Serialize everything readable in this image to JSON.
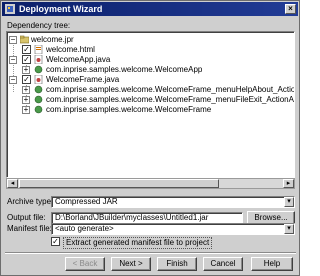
{
  "window": {
    "title": "Deployment Wizard",
    "close_glyph": "×"
  },
  "tree": {
    "label": "Dependency tree:",
    "rows": [
      {
        "text": "welcome.jpr",
        "expander": "−",
        "checkbox": "",
        "icon": "folder-icon"
      },
      {
        "text": "welcome.html",
        "expander": "",
        "checkbox": "✓",
        "icon": "html-file-icon"
      },
      {
        "text": "WelcomeApp.java",
        "expander": "−",
        "checkbox": "✓",
        "icon": "java-file-icon"
      },
      {
        "text": "com.inprise.samples.welcome.WelcomeApp",
        "expander": "+",
        "checkbox": "✓",
        "icon": "class-icon"
      },
      {
        "text": "WelcomeFrame.java",
        "expander": "−",
        "checkbox": "✓",
        "icon": "java-file-icon"
      },
      {
        "text": "com.inprise.samples.welcome.WelcomeFrame_menuHelpAbout_ActionAd",
        "expander": "+",
        "checkbox": "✓",
        "icon": "class-icon"
      },
      {
        "text": "com.inprise.samples.welcome.WelcomeFrame_menuFileExit_ActionAdapt",
        "expander": "+",
        "checkbox": "✓",
        "icon": "class-icon"
      },
      {
        "text": "com.inprise.samples.welcome.WelcomeFrame",
        "expander": "+",
        "checkbox": "✓",
        "icon": "class-icon"
      }
    ]
  },
  "scroll": {
    "left_glyph": "◂",
    "right_glyph": "▸"
  },
  "form": {
    "archive_type": {
      "label": "Archive type:",
      "value": "Compressed JAR",
      "arrow": "▾"
    },
    "output_file": {
      "label": "Output file:",
      "value": "D:\\Borland\\JBuilder\\myclasses\\Untitled1.jar",
      "browse_label": "Browse..."
    },
    "manifest_file": {
      "label": "Manifest file:",
      "value": "<auto generate>",
      "arrow": "▾"
    },
    "extract_manifest": {
      "label": "Extract generated manifest file to project",
      "checked_glyph": "✓"
    }
  },
  "buttons": {
    "back": "< Back",
    "next": "Next >",
    "finish": "Finish",
    "cancel": "Cancel",
    "help": "Help"
  },
  "colors": {
    "title_bar": "#0b1f69",
    "dialog_bg": "#cfcfcf",
    "panel_bg": "#ffffff"
  }
}
